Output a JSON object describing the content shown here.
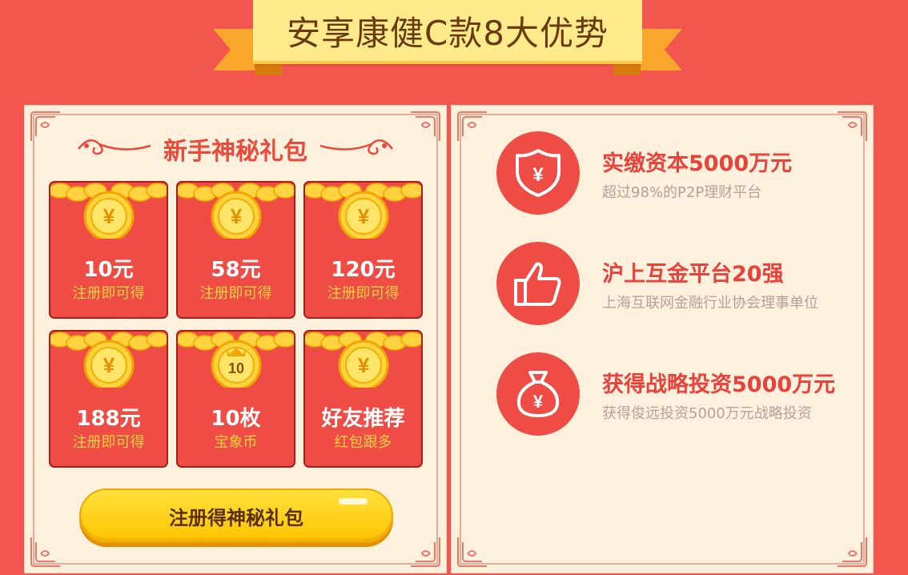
{
  "header": {
    "title": "安享康健C款8大优势"
  },
  "gift": {
    "title": "新手神秘礼包",
    "cards": [
      {
        "amount": "10元",
        "sub": "注册即可得",
        "coin": "yen"
      },
      {
        "amount": "58元",
        "sub": "注册即可得",
        "coin": "yen"
      },
      {
        "amount": "120元",
        "sub": "注册即可得",
        "coin": "yen"
      },
      {
        "amount": "188元",
        "sub": "注册即可得",
        "coin": "yen"
      },
      {
        "amount": "10枚",
        "sub": "宝象币",
        "coin": "crown",
        "coin_text": "10"
      },
      {
        "amount": "好友推荐",
        "sub": "红包跟多",
        "coin": "yen"
      }
    ],
    "button_label": "注册得神秘礼包"
  },
  "advantages": [
    {
      "icon": "shield-yen-icon",
      "heading": "实缴资本5000万元",
      "desc": "超过98%的P2P理财平台"
    },
    {
      "icon": "thumbs-up-icon",
      "heading": "沪上互金平台20强",
      "desc": "上海互联网金融行业协会理事单位"
    },
    {
      "icon": "money-bag-icon",
      "heading": "获得战略投资5000万元",
      "desc": "获得俊远投资5000万元战略投资"
    }
  ],
  "colors": {
    "background": "#f2564f",
    "panel": "#fdf1de",
    "accent_red": "#f04c46",
    "gold": "#ffd23f",
    "button": "#ffc400"
  }
}
